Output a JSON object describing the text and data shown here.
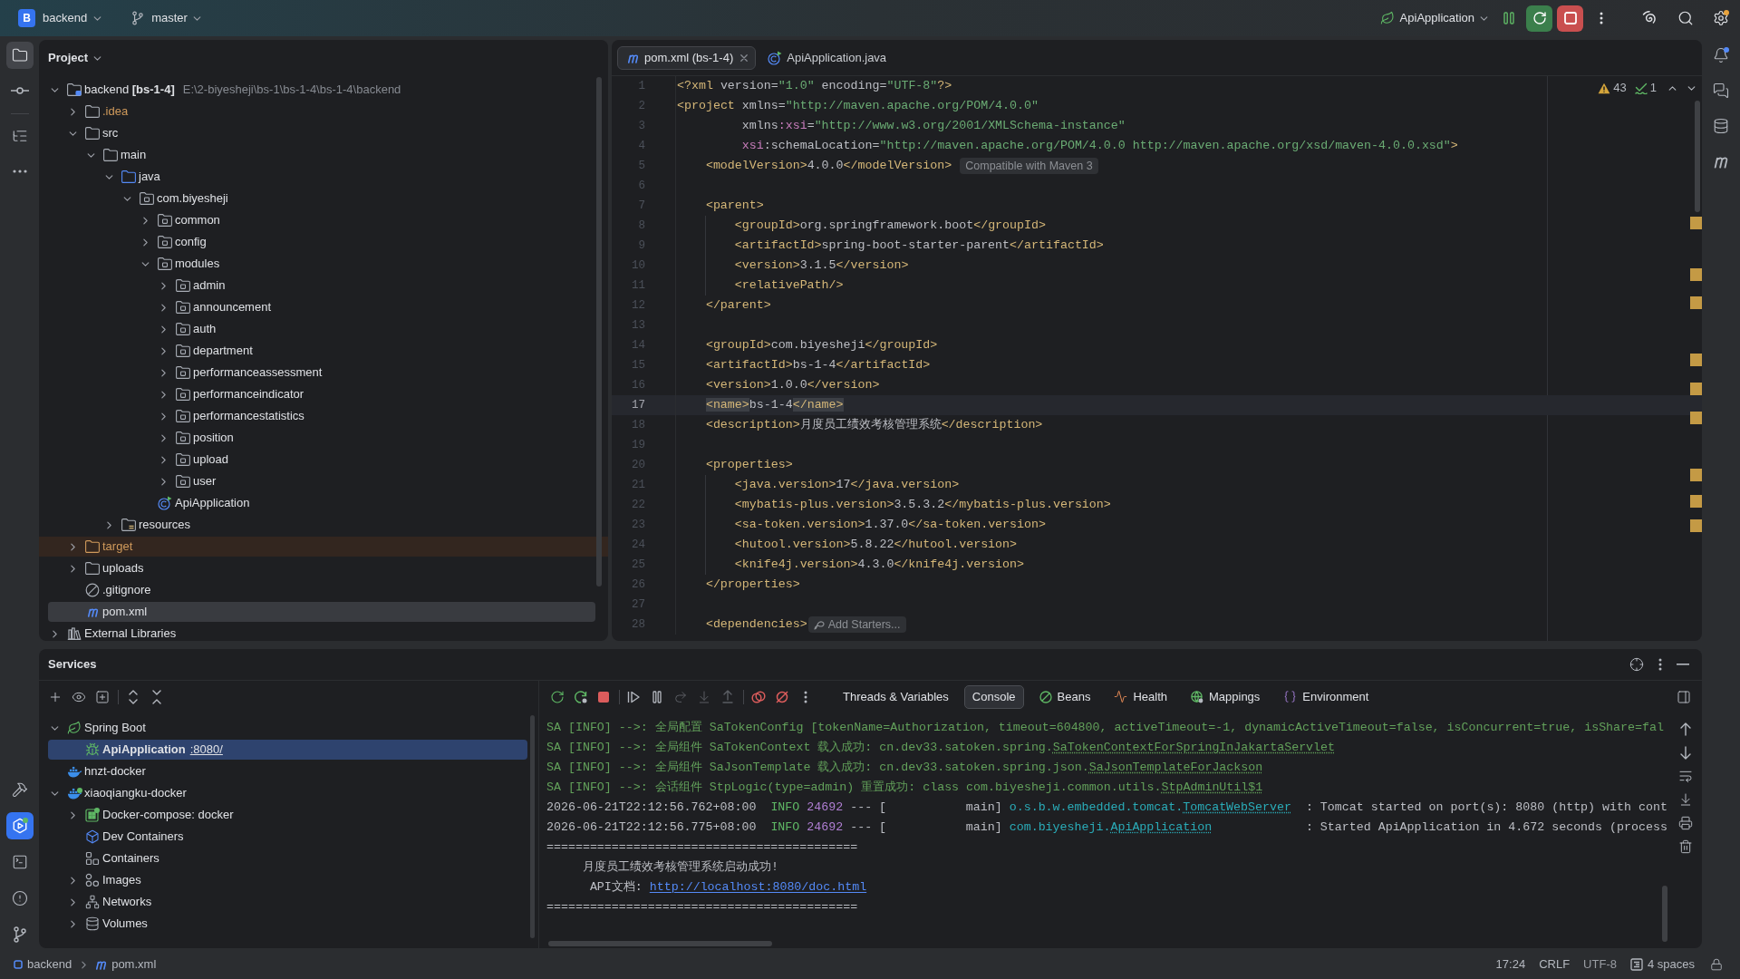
{
  "toolbar": {
    "project_badge": "B",
    "project": "backend",
    "branch": "master",
    "run_config": "ApiApplication",
    "settings_alert": true
  },
  "left_strip": {
    "top": [
      {
        "kind": "project",
        "selected": true
      },
      {
        "kind": "commit",
        "selected": false
      },
      {
        "kind": "structure",
        "selected": false
      },
      {
        "kind": "more",
        "selected": false
      }
    ],
    "bottom": [
      {
        "kind": "build",
        "selected": false,
        "running": false
      },
      {
        "kind": "services",
        "selected": true,
        "running": true
      },
      {
        "kind": "terminal",
        "selected": false,
        "running": false
      },
      {
        "kind": "problems",
        "selected": false,
        "running": false
      },
      {
        "kind": "git",
        "selected": false,
        "running": false
      }
    ]
  },
  "project_panel": {
    "title": "Project",
    "tree": [
      {
        "label": "backend **[bs-1-4]**",
        "path": "E:\\2-biyesheji\\bs-1\\bs-1-4\\bs-1-4\\backend",
        "kind": "module",
        "expanded": true,
        "selected": false,
        "children": [
          {
            "label": ".idea",
            "kind": "ignored",
            "expanded": false,
            "selected": false
          },
          {
            "label": "src",
            "kind": "folder",
            "expanded": true,
            "selected": false,
            "children": [
              {
                "label": "main",
                "kind": "folder",
                "expanded": true,
                "selected": false,
                "children": [
                  {
                    "label": "java",
                    "kind": "source",
                    "expanded": true,
                    "selected": false,
                    "children": [
                      {
                        "label": "com.biyesheji",
                        "kind": "package",
                        "expanded": true,
                        "selected": false,
                        "children": [
                          {
                            "label": "common",
                            "kind": "package",
                            "expanded": false,
                            "selected": false
                          },
                          {
                            "label": "config",
                            "kind": "package",
                            "expanded": false,
                            "selected": false
                          },
                          {
                            "label": "modules",
                            "kind": "package",
                            "expanded": true,
                            "selected": false,
                            "children": [
                              {
                                "label": "admin",
                                "kind": "package",
                                "expanded": false,
                                "selected": false
                              },
                              {
                                "label": "announcement",
                                "kind": "package",
                                "expanded": false,
                                "selected": false
                              },
                              {
                                "label": "auth",
                                "kind": "package",
                                "expanded": false,
                                "selected": false
                              },
                              {
                                "label": "department",
                                "kind": "package",
                                "expanded": false,
                                "selected": false
                              },
                              {
                                "label": "performanceassessment",
                                "kind": "package",
                                "expanded": false,
                                "selected": false
                              },
                              {
                                "label": "performanceindicator",
                                "kind": "package",
                                "expanded": false,
                                "selected": false
                              },
                              {
                                "label": "performancestatistics",
                                "kind": "package",
                                "expanded": false,
                                "selected": false
                              },
                              {
                                "label": "position",
                                "kind": "package",
                                "expanded": false,
                                "selected": false
                              },
                              {
                                "label": "upload",
                                "kind": "package",
                                "expanded": false,
                                "selected": false
                              },
                              {
                                "label": "user",
                                "kind": "package",
                                "expanded": false,
                                "selected": false
                              }
                            ]
                          },
                          {
                            "label": "ApiApplication",
                            "kind": "class",
                            "selected": false
                          }
                        ]
                      }
                    ]
                  },
                  {
                    "label": "resources",
                    "kind": "resources",
                    "expanded": false,
                    "selected": false
                  }
                ]
              }
            ]
          },
          {
            "label": "target",
            "kind": "excluded",
            "expanded": false,
            "selected": false
          },
          {
            "label": "uploads",
            "kind": "folder",
            "expanded": false,
            "selected": false
          },
          {
            "label": ".gitignore",
            "kind": "ignorefile",
            "selected": false
          },
          {
            "label": "pom.xml",
            "kind": "maven",
            "selected": true
          }
        ]
      },
      {
        "label": "External Libraries",
        "kind": "libraries",
        "expanded": false,
        "selected": false
      }
    ]
  },
  "editor": {
    "tabs": [
      {
        "label": "pom.xml (bs-1-4)",
        "kind": "maven",
        "selected": true,
        "closable": true
      },
      {
        "label": "ApiApplication.java",
        "kind": "class",
        "selected": false,
        "closable": false
      }
    ],
    "inspections": {
      "warnings": "43",
      "weak_warnings": "1"
    },
    "lines": [
      {
        "number": "1",
        "current": false,
        "tokens": [
          {
            "kind": "tag",
            "text": "<?xml"
          },
          {
            "kind": "text",
            "text": " version="
          },
          {
            "kind": "value",
            "text": "\"1.0\""
          },
          {
            "kind": "text",
            "text": " encoding="
          },
          {
            "kind": "value",
            "text": "\"UTF-8\""
          },
          {
            "kind": "tag",
            "text": "?>"
          }
        ]
      },
      {
        "number": "2",
        "current": false,
        "tokens": [
          {
            "kind": "tag",
            "text": "<project"
          },
          {
            "kind": "text",
            "text": " xmlns="
          },
          {
            "kind": "value",
            "text": "\"http://maven.apache.org/POM/4.0.0\""
          }
        ]
      },
      {
        "number": "3",
        "current": false,
        "tokens": [
          {
            "kind": "text",
            "text": "         xmlns"
          },
          {
            "kind": "ns",
            "text": ":xsi"
          },
          {
            "kind": "text",
            "text": "="
          },
          {
            "kind": "value",
            "text": "\"http://www.w3.org/2001/XMLSchema-instance\""
          }
        ]
      },
      {
        "number": "4",
        "current": false,
        "tokens": [
          {
            "kind": "ns",
            "text": "         xsi"
          },
          {
            "kind": "text",
            "text": ":schemaLocation="
          },
          {
            "kind": "value",
            "text": "\"http://maven.apache.org/POM/4.0.0 http://maven.apache.org/xsd/maven-4.0.0.xsd\""
          },
          {
            "kind": "tag",
            "text": ">"
          }
        ]
      },
      {
        "number": "5",
        "current": false,
        "tokens": [
          {
            "kind": "tag",
            "text": "    <modelVersion>"
          },
          {
            "kind": "text",
            "text": "4.0.0"
          },
          {
            "kind": "tag",
            "text": "</modelVersion>"
          }
        ],
        "hint": {
          "kind": "info",
          "text": "Compatible with Maven 3"
        }
      },
      {
        "number": "6",
        "current": false
      },
      {
        "number": "7",
        "current": false,
        "tokens": [
          {
            "kind": "tag",
            "text": "    <parent>"
          }
        ]
      },
      {
        "number": "8",
        "current": false,
        "tokens": [
          {
            "kind": "tag",
            "text": "        <groupId>"
          },
          {
            "kind": "text",
            "text": "org.springframework.boot"
          },
          {
            "kind": "tag",
            "text": "</groupId>"
          }
        ]
      },
      {
        "number": "9",
        "current": false,
        "tokens": [
          {
            "kind": "tag",
            "text": "        <artifactId>"
          },
          {
            "kind": "text",
            "text": "spring-boot-starter-parent"
          },
          {
            "kind": "tag",
            "text": "</artifactId>"
          }
        ]
      },
      {
        "number": "10",
        "current": false,
        "tokens": [
          {
            "kind": "tag",
            "text": "        <version>"
          },
          {
            "kind": "text",
            "text": "3.1.5"
          },
          {
            "kind": "tag",
            "text": "</version>"
          }
        ]
      },
      {
        "number": "11",
        "current": false,
        "tokens": [
          {
            "kind": "tag",
            "text": "        <relativePath/>"
          }
        ]
      },
      {
        "number": "12",
        "current": false,
        "tokens": [
          {
            "kind": "tag",
            "text": "    </parent>"
          }
        ]
      },
      {
        "number": "13",
        "current": false
      },
      {
        "number": "14",
        "current": false,
        "tokens": [
          {
            "kind": "tag",
            "text": "    <groupId>"
          },
          {
            "kind": "text",
            "text": "com.biyesheji"
          },
          {
            "kind": "tag",
            "text": "</groupId>"
          }
        ]
      },
      {
        "number": "15",
        "current": false,
        "tokens": [
          {
            "kind": "tag",
            "text": "    <artifactId>"
          },
          {
            "kind": "text",
            "text": "bs-1-4"
          },
          {
            "kind": "tag",
            "text": "</artifactId>"
          }
        ]
      },
      {
        "number": "16",
        "current": false,
        "tokens": [
          {
            "kind": "tag",
            "text": "    <version>"
          },
          {
            "kind": "text",
            "text": "1.0.0"
          },
          {
            "kind": "tag",
            "text": "</version>"
          }
        ]
      },
      {
        "number": "17",
        "current": true,
        "tokens": [
          {
            "kind": "match",
            "text": "    <name>"
          },
          {
            "kind": "text",
            "text": "bs-1-4"
          },
          {
            "kind": "match",
            "text": "</name>"
          }
        ]
      },
      {
        "number": "18",
        "current": false,
        "tokens": [
          {
            "kind": "tag",
            "text": "    <description>"
          },
          {
            "kind": "text",
            "text": "月度员工绩效考核管理系统"
          },
          {
            "kind": "tag",
            "text": "</description>"
          }
        ]
      },
      {
        "number": "19",
        "current": false
      },
      {
        "number": "20",
        "current": false,
        "tokens": [
          {
            "kind": "tag",
            "text": "    <properties>"
          }
        ]
      },
      {
        "number": "21",
        "current": false,
        "tokens": [
          {
            "kind": "tag",
            "text": "        <java.version>"
          },
          {
            "kind": "text",
            "text": "17"
          },
          {
            "kind": "tag",
            "text": "</java.version>"
          }
        ]
      },
      {
        "number": "22",
        "current": false,
        "tokens": [
          {
            "kind": "tag",
            "text": "        <mybatis-plus.version>"
          },
          {
            "kind": "text",
            "text": "3.5.3.2"
          },
          {
            "kind": "tag",
            "text": "</mybatis-plus.version>"
          }
        ]
      },
      {
        "number": "23",
        "current": false,
        "tokens": [
          {
            "kind": "tag",
            "text": "        <sa-token.version>"
          },
          {
            "kind": "text",
            "text": "1.37.0"
          },
          {
            "kind": "tag",
            "text": "</sa-token.version>"
          }
        ]
      },
      {
        "number": "24",
        "current": false,
        "tokens": [
          {
            "kind": "tag",
            "text": "        <hutool.version>"
          },
          {
            "kind": "text",
            "text": "5.8.22"
          },
          {
            "kind": "tag",
            "text": "</hutool.version>"
          }
        ]
      },
      {
        "number": "25",
        "current": false,
        "tokens": [
          {
            "kind": "tag",
            "text": "        <knife4j.version>"
          },
          {
            "kind": "text",
            "text": "4.3.0"
          },
          {
            "kind": "tag",
            "text": "</knife4j.version>"
          }
        ]
      },
      {
        "number": "26",
        "current": false,
        "tokens": [
          {
            "kind": "tag",
            "text": "    </properties>"
          }
        ]
      },
      {
        "number": "27",
        "current": false
      },
      {
        "number": "28",
        "current": false,
        "tokens": [
          {
            "kind": "tag",
            "text": "    <dependencies>"
          }
        ],
        "hint": {
          "kind": "action",
          "text": "Add Starters..."
        }
      }
    ]
  },
  "right_strip": {
    "notifications_unread": true
  },
  "services": {
    "title": "Services",
    "tree": [
      {
        "label": "Spring Boot",
        "kind": "spring",
        "expanded": true,
        "selected": false,
        "running": false,
        "children": [
          {
            "label": "ApiApplication",
            "port": ":8080/",
            "kind": "debug",
            "selected": true,
            "running": false
          }
        ]
      },
      {
        "label": "hnzt-docker",
        "kind": "docker",
        "selected": false,
        "running": false
      },
      {
        "label": "xiaoqiangku-docker",
        "kind": "docker",
        "expanded": true,
        "selected": false,
        "running": true,
        "children": [
          {
            "label": "Docker-compose: docker",
            "kind": "compose",
            "expanded": false,
            "selected": false,
            "running": true
          },
          {
            "label": "Dev Containers",
            "kind": "devcontainers",
            "selected": false,
            "running": false
          },
          {
            "label": "Containers",
            "kind": "containers",
            "selected": false,
            "running": false
          },
          {
            "label": "Images",
            "kind": "images",
            "expanded": false,
            "selected": false,
            "running": false
          },
          {
            "label": "Networks",
            "kind": "networks",
            "expanded": false,
            "selected": false,
            "running": false
          },
          {
            "label": "Volumes",
            "kind": "volumes",
            "expanded": false,
            "selected": false,
            "running": false
          }
        ]
      }
    ],
    "debug_tabs": [
      {
        "label": "Threads & Variables",
        "kind": "threads",
        "selected": false
      },
      {
        "label": "Console",
        "kind": "console",
        "selected": true
      },
      {
        "label": "Beans",
        "kind": "beans",
        "selected": false
      },
      {
        "label": "Health",
        "kind": "health",
        "selected": false
      },
      {
        "label": "Mappings",
        "kind": "mappings",
        "selected": false
      },
      {
        "label": "Environment",
        "kind": "environment",
        "selected": false
      }
    ],
    "console": [
      {
        "tokens": [
          {
            "kind": "sa",
            "text": "SA [INFO] -->: 全局配置 SaTokenConfig [tokenName=Authorization, timeout=604800, activeTimeout=-1, dynamicActiveTimeout=false, isConcurrent=true, isShare=fal"
          }
        ]
      },
      {
        "tokens": [
          {
            "kind": "sa",
            "text": "SA [INFO] -->: 全局组件 SaTokenContext 载入成功: cn.dev33.satoken.spring."
          },
          {
            "kind": "salink",
            "text": "SaTokenContextForSpringInJakartaServlet"
          }
        ]
      },
      {
        "tokens": [
          {
            "kind": "sa",
            "text": "SA [INFO] -->: 全局组件 SaJsonTemplate 载入成功: cn.dev33.satoken.spring.json."
          },
          {
            "kind": "salink",
            "text": "SaJsonTemplateForJackson"
          }
        ]
      },
      {
        "tokens": [
          {
            "kind": "sa",
            "text": "SA [INFO] -->: 会话组件 StpLogic(type=admin) 重置成功: class com.biyesheji.common.utils."
          },
          {
            "kind": "salink",
            "text": "StpAdminUtil$1"
          }
        ]
      },
      {
        "tokens": [
          {
            "kind": "plain",
            "text": "2026-06-21T22:12:56.762+08:00  "
          },
          {
            "kind": "info",
            "text": "INFO"
          },
          {
            "kind": "pid",
            "text": " 24692"
          },
          {
            "kind": "plain",
            "text": " --- [           main] "
          },
          {
            "kind": "logger",
            "text": "o.s.b.w.embedded.tomcat."
          },
          {
            "kind": "loggerlink",
            "text": "TomcatWebServer"
          },
          {
            "kind": "plain",
            "text": "  : Tomcat started on port(s): 8080 (http) with cont"
          }
        ]
      },
      {
        "tokens": [
          {
            "kind": "plain",
            "text": "2026-06-21T22:12:56.775+08:00  "
          },
          {
            "kind": "info",
            "text": "INFO"
          },
          {
            "kind": "pid",
            "text": " 24692"
          },
          {
            "kind": "plain",
            "text": " --- [           main] "
          },
          {
            "kind": "logger",
            "text": "com.biyesheji."
          },
          {
            "kind": "loggerlink",
            "text": "ApiApplication"
          },
          {
            "kind": "plain",
            "text": "             : Started ApiApplication in 4.672 seconds (process"
          }
        ]
      },
      {
        "tokens": [
          {
            "kind": "plain",
            "text": "==========================================="
          }
        ]
      },
      {
        "tokens": [
          {
            "kind": "plain",
            "text": "     月度员工绩效考核管理系统启动成功!"
          }
        ]
      },
      {
        "tokens": [
          {
            "kind": "plain",
            "text": "      API文档: "
          },
          {
            "kind": "url",
            "text": "http://localhost:8080/doc.html"
          }
        ]
      },
      {
        "tokens": [
          {
            "kind": "plain",
            "text": "==========================================="
          }
        ]
      }
    ]
  },
  "status_bar": {
    "breadcrumbs": [
      {
        "kind": "module",
        "label": "backend"
      },
      {
        "kind": "maven",
        "label": "pom.xml"
      }
    ],
    "position": "17:24",
    "line_separator": "CRLF",
    "encoding": "UTF-8",
    "indent": "4 spaces"
  }
}
